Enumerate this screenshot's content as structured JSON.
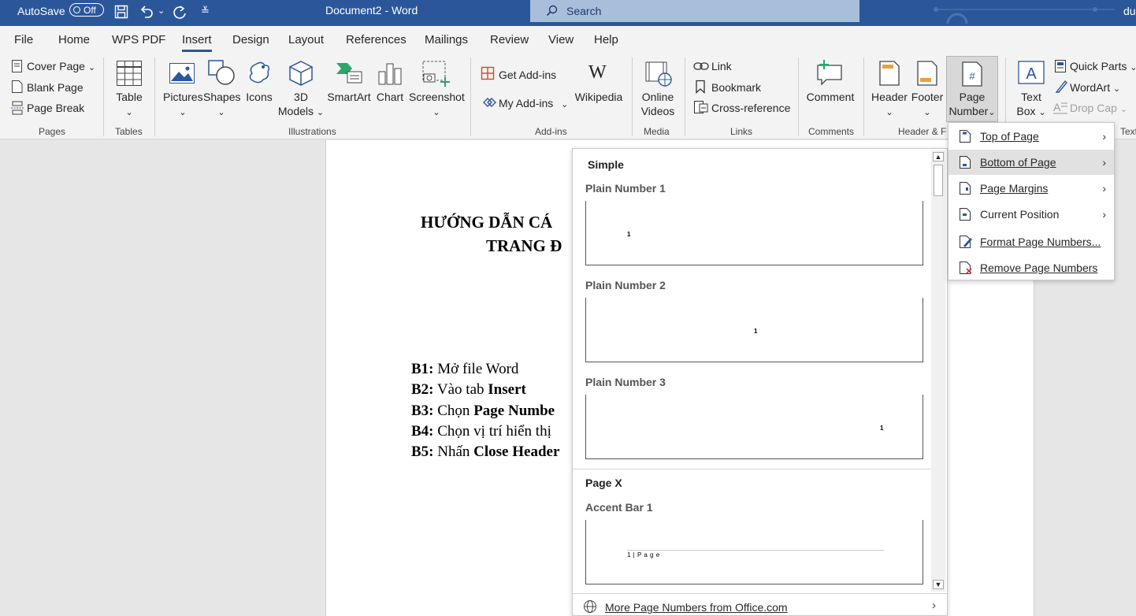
{
  "titlebar": {
    "autosave_label": "AutoSave",
    "autosave_state": "Off",
    "doc_title": "Document2  -  Word",
    "search_placeholder": "Search",
    "user_partial": "du"
  },
  "tabs": [
    "File",
    "Home",
    "WPS PDF",
    "Insert",
    "Design",
    "Layout",
    "References",
    "Mailings",
    "Review",
    "View",
    "Help"
  ],
  "active_tab": "Insert",
  "ribbon": {
    "pages": {
      "cover_page": "Cover Page",
      "blank_page": "Blank Page",
      "page_break": "Page Break",
      "group": "Pages"
    },
    "tables": {
      "table": "Table",
      "group": "Tables"
    },
    "illustrations": {
      "pictures": "Pictures",
      "shapes": "Shapes",
      "icons": "Icons",
      "models_3d_line1": "3D",
      "models_3d_line2": "Models",
      "smartart": "SmartArt",
      "chart": "Chart",
      "screenshot": "Screenshot",
      "group": "Illustrations"
    },
    "addins": {
      "get_addins": "Get Add-ins",
      "my_addins": "My Add-ins",
      "wikipedia": "Wikipedia",
      "group": "Add-ins"
    },
    "media": {
      "online_videos_line1": "Online",
      "online_videos_line2": "Videos",
      "group": "Media"
    },
    "links": {
      "link": "Link",
      "bookmark": "Bookmark",
      "cross_reference": "Cross-reference",
      "group": "Links"
    },
    "comments": {
      "comment": "Comment",
      "group": "Comments"
    },
    "header_footer": {
      "header": "Header",
      "footer": "Footer",
      "page_number_line1": "Page",
      "page_number_line2": "Number",
      "group": "Header & F"
    },
    "text": {
      "text_box_line1": "Text",
      "text_box_line2": "Box",
      "quick_parts": "Quick Parts",
      "wordart": "WordArt",
      "drop_cap": "Drop Cap",
      "group": "Text"
    }
  },
  "document": {
    "title_line1": "HƯỚNG DẪN CÁ",
    "title_line2": "TRANG Đ",
    "steps": [
      {
        "label": "B1:",
        "text": " Mở file Word",
        "bold": ""
      },
      {
        "label": "B2:",
        "text": " Vào tab ",
        "bold": "Insert"
      },
      {
        "label": "B3:",
        "text": " Chọn ",
        "bold": "Page Numbe"
      },
      {
        "label": "B4:",
        "text": " Chọn vị trí hiển thị",
        "bold": ""
      },
      {
        "label": "B5:",
        "text": " Nhấn ",
        "bold": "Close Header"
      }
    ]
  },
  "gallery": {
    "section_simple": "Simple",
    "items": [
      {
        "label": "Plain Number 1",
        "num": "1"
      },
      {
        "label": "Plain Number 2",
        "num": "1"
      },
      {
        "label": "Plain Number 3",
        "num": "1"
      }
    ],
    "section_pagex": "Page X",
    "accent_bar_label": "Accent Bar 1",
    "accent_bar_text": "1 | P a g e",
    "more": "More Page Numbers from Office.com"
  },
  "submenu": {
    "items": [
      "Top of Page",
      "Bottom of Page",
      "Page Margins",
      "Current Position",
      "Format Page Numbers...",
      "Remove Page Numbers"
    ],
    "highlighted": "Bottom of Page"
  }
}
